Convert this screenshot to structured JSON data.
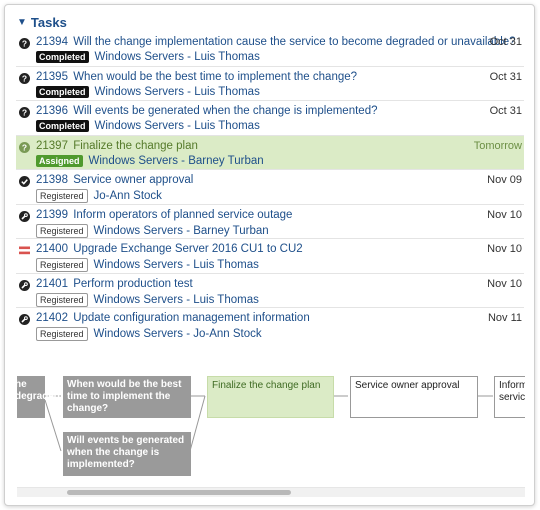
{
  "section": {
    "title": "Tasks"
  },
  "tasks": [
    {
      "id": "21394",
      "title": "Will the change implementation cause the service to become degraded or unavailable?",
      "status": "Completed",
      "owner": "Windows Servers - Luis Thomas",
      "date": "Oct 31",
      "icon": "question-icon"
    },
    {
      "id": "21395",
      "title": "When would be the best time to implement the change?",
      "status": "Completed",
      "owner": "Windows Servers - Luis Thomas",
      "date": "Oct 31",
      "icon": "question-icon"
    },
    {
      "id": "21396",
      "title": "Will events be generated when the change is implemented?",
      "status": "Completed",
      "owner": "Windows Servers - Luis Thomas",
      "date": "Oct 31",
      "icon": "question-icon"
    },
    {
      "id": "21397",
      "title": "Finalize the change plan",
      "status": "Assigned",
      "owner": "Windows Servers - Barney Turban",
      "date": "Tomorrow",
      "icon": "question-icon",
      "highlight": true
    },
    {
      "id": "21398",
      "title": "Service owner approval",
      "status": "Registered",
      "owner": "Jo-Ann Stock",
      "date": "Nov 09",
      "icon": "approval-check-icon"
    },
    {
      "id": "21399",
      "title": "Inform operators of planned service outage",
      "status": "Registered",
      "owner": "Windows Servers - Barney Turban",
      "date": "Nov 10",
      "icon": "wrench-icon"
    },
    {
      "id": "21400",
      "title": "Upgrade Exchange Server 2016 CU1 to CU2",
      "status": "Registered",
      "owner": "Windows Servers - Luis Thomas",
      "date": "Nov 10",
      "icon": "implementation-bars-icon"
    },
    {
      "id": "21401",
      "title": "Perform production test",
      "status": "Registered",
      "owner": "Windows Servers - Luis Thomas",
      "date": "Nov 10",
      "icon": "wrench-icon"
    },
    {
      "id": "21402",
      "title": "Update configuration management information",
      "status": "Registered",
      "owner": "Windows Servers - Jo-Ann Stock",
      "date": "Nov 11",
      "icon": "wrench-icon"
    }
  ],
  "flow": {
    "node_partial": "he\ndegraded",
    "node_best_time": "When would be the best time to implement the change?",
    "node_events": "Will events be generated when the change is implemented?",
    "node_finalize": "Finalize the change plan",
    "node_approval": "Service owner approval",
    "node_inform": "Inform o\nservice"
  },
  "colors": {
    "link": "#1e4f8a",
    "highlight": "#dbebc6",
    "assigned": "#4f9a2e",
    "implementation": "#d9534f"
  }
}
